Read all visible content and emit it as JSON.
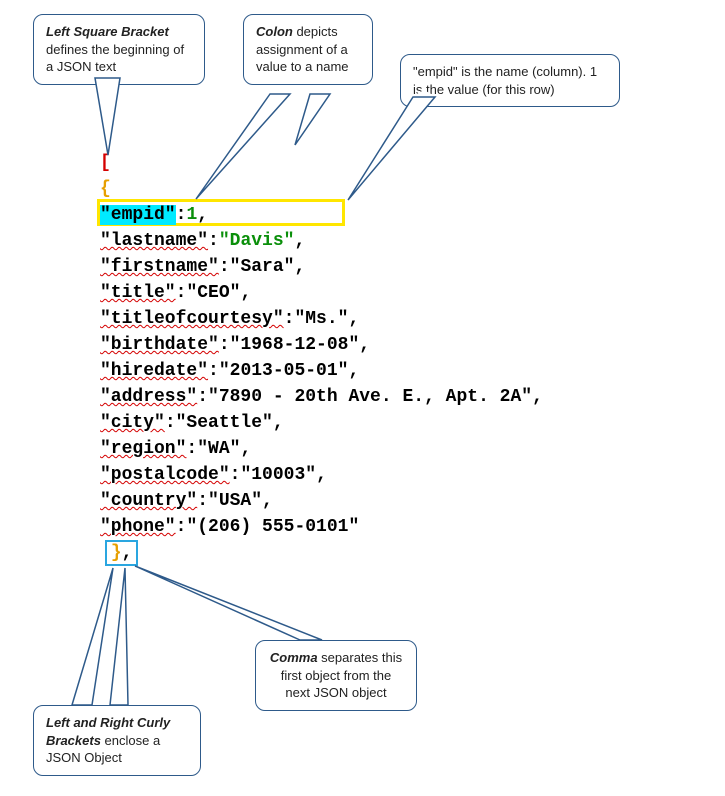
{
  "callouts": {
    "leftBracket": {
      "bold": "Left Square Bracket",
      "rest": " defines the beginning of a JSON text"
    },
    "colon": {
      "bold": "Colon",
      "rest": " depicts assignment of a value to a name"
    },
    "empid": {
      "text": "\"empid\" is the name (column). 1 is the value (for this row)"
    },
    "curly": {
      "bold": "Left and Right Curly Brackets",
      "rest": " enclose a JSON Object"
    },
    "comma": {
      "bold": "Comma",
      "rest": " separates this first object from the next JSON object"
    }
  },
  "json_sample": {
    "empid": 1,
    "lastname": "Davis",
    "firstname": "Sara",
    "title": "CEO",
    "titleofcourtesy": "Ms.",
    "birthdate": "1968-12-08",
    "hiredate": "2013-05-01",
    "address": "7890 - 20th Ave. E., Apt. 2A",
    "city": "Seattle",
    "region": "WA",
    "postalcode": "10003",
    "country": "USA",
    "phone": "(206) 555-0101"
  },
  "keys_order": [
    "empid",
    "lastname",
    "firstname",
    "title",
    "titleofcourtesy",
    "birthdate",
    "hiredate",
    "address",
    "city",
    "region",
    "postalcode",
    "country",
    "phone"
  ]
}
